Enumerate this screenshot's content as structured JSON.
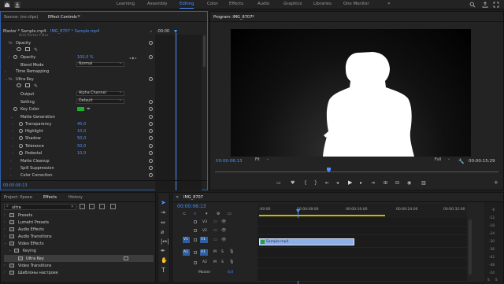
{
  "workspaces": {
    "items": [
      "Learning",
      "Assembly",
      "Editing",
      "Color",
      "Effects",
      "Audio",
      "Graphics",
      "Libraries",
      "One Monitor"
    ],
    "active": "Editing",
    "more": "»"
  },
  "left_panel": {
    "tabs": [
      "Source: (no clips)",
      "Effect Controls"
    ],
    "menu": "≡",
    "master": "Master * Sample.mp4",
    "clip": "IMG_8707 * Sample.mp4",
    "time_label": ":00:00",
    "cut_row": "Anti-flicker Filter",
    "fx": [
      {
        "label": "fx",
        "name": "Opacity"
      },
      {
        "name": "Opacity",
        "value": "100,0 %"
      },
      {
        "name": "Blend Mode",
        "value": "Normal"
      },
      {
        "label": "",
        "name": "Time Remapping"
      },
      {
        "label": "fx",
        "name": "Ultra Key"
      },
      {
        "name": "Output",
        "value": "Alpha Channel"
      },
      {
        "name": "Setting",
        "value": "Default"
      },
      {
        "name": "Key Color"
      },
      {
        "name": "Matte Generation"
      },
      {
        "name": "Transparency",
        "value": "45,0"
      },
      {
        "name": "Highlight",
        "value": "10,0"
      },
      {
        "name": "Shadow",
        "value": "50,0"
      },
      {
        "name": "Tolerance",
        "value": "50,0"
      },
      {
        "name": "Pedestal",
        "value": "10,0"
      },
      {
        "name": "Matte Cleanup"
      },
      {
        "name": "Spill Suppression"
      },
      {
        "name": "Color Correction"
      }
    ],
    "timecode": "00:00:06:13"
  },
  "program": {
    "title": "Program: IMG_8707",
    "menu": "≡",
    "timecode": "00:00:06:13",
    "fit": "Fit",
    "quality": "Full",
    "duration": "00:00:15:29"
  },
  "bottom_left": {
    "tabs": [
      "Project: Уроки",
      "Effects",
      "History"
    ],
    "search_value": "ultra",
    "tree": [
      {
        "name": "Presets",
        "indent": 0
      },
      {
        "name": "Lumetri Presets",
        "indent": 0
      },
      {
        "name": "Audio Effects",
        "indent": 0
      },
      {
        "name": "Audio Transitions",
        "indent": 0
      },
      {
        "name": "Video Effects",
        "indent": 0
      },
      {
        "name": "Keying",
        "indent": 1
      },
      {
        "name": "Ultra Key",
        "indent": 2
      },
      {
        "name": "Video Transitions",
        "indent": 0
      },
      {
        "name": "Шаблоны настроек",
        "indent": 0
      }
    ]
  },
  "timeline": {
    "title": "IMG_8707",
    "timecode": "00:00:06:13",
    "ruler": [
      ":00:00",
      "00:00:08:00",
      "00:00:16:00",
      "00:00:24:00",
      "00:00:32:00"
    ],
    "tracks": [
      {
        "id": "V3"
      },
      {
        "id": "V2"
      },
      {
        "id": "V1",
        "target": "V1"
      },
      {
        "id": "A1",
        "target": "A1"
      },
      {
        "id": "A2"
      }
    ],
    "master": "Master",
    "master_value": "0,0",
    "clip": "Sample.mp4",
    "meter": [
      "-6",
      "-12",
      "-18",
      "-24",
      "-30",
      "-36",
      "-42",
      "-48",
      "-54"
    ],
    "meter_bottom": [
      "S",
      "S"
    ]
  }
}
